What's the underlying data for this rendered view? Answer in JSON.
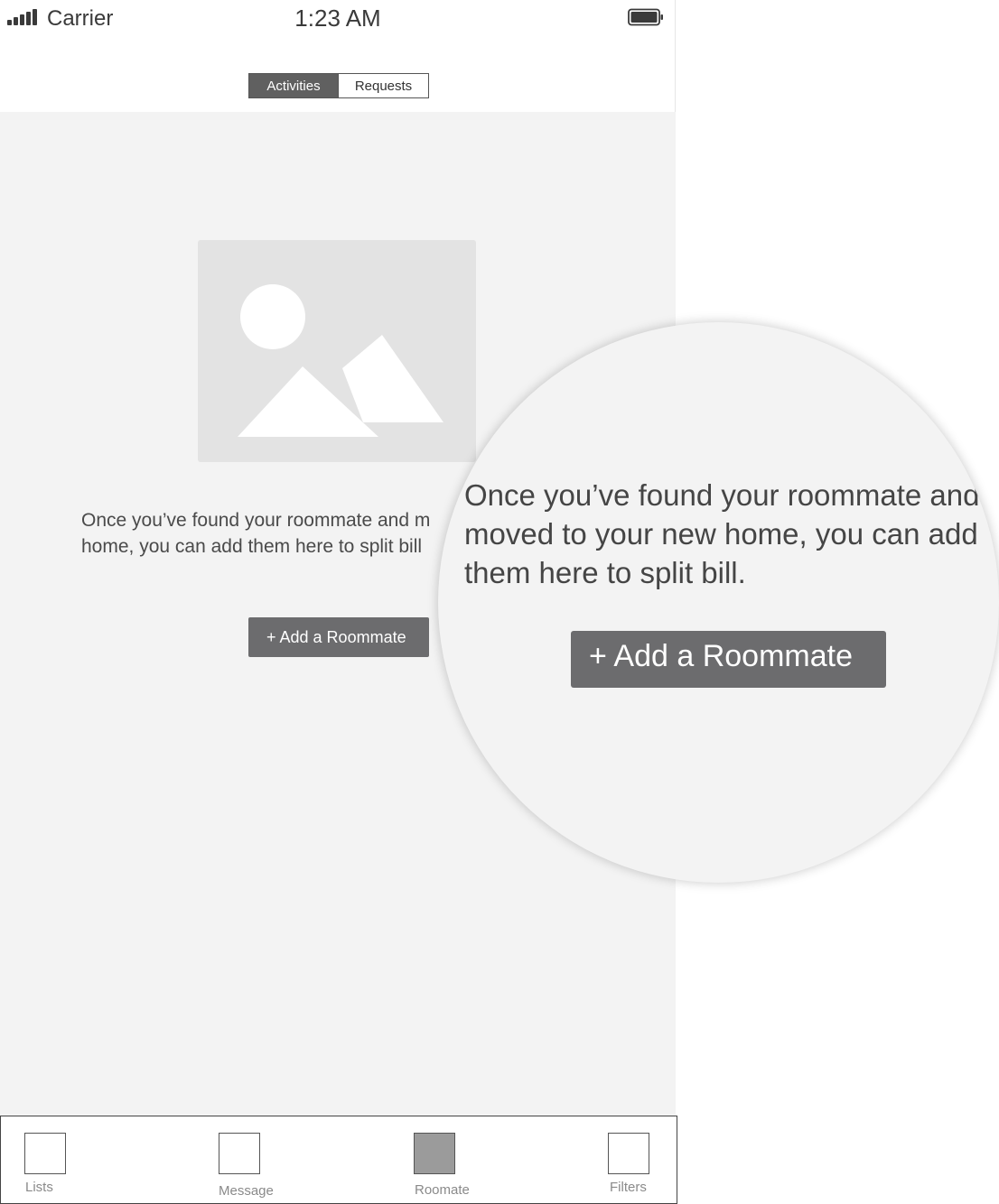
{
  "status_bar": {
    "carrier": "Carrier",
    "time": "1:23 AM",
    "signal_icon": "signal-bars-icon",
    "battery_icon": "battery-full-icon"
  },
  "segmented_control": {
    "tabs": [
      {
        "label": "Activities",
        "selected": true
      },
      {
        "label": "Requests",
        "selected": false
      }
    ]
  },
  "empty_state": {
    "image_icon": "image-placeholder-icon",
    "line1": "Once you’ve found your roommate and m",
    "line2": "home, you can add them here to split bill",
    "add_button_label": "+ Add a Roommate"
  },
  "magnifier": {
    "line1": "Once you’ve found your roommate and",
    "line2": "moved to your new home, you can add",
    "line3": "them here to split bill.",
    "button_label": "+ Add a Roommate"
  },
  "tab_bar": {
    "items": [
      {
        "label": "Lists",
        "icon": "square-outline-icon",
        "selected": false
      },
      {
        "label": "Message",
        "icon": "square-outline-icon",
        "selected": false
      },
      {
        "label": "Roomate",
        "icon": "square-filled-icon",
        "selected": true
      },
      {
        "label": "Filters",
        "icon": "square-outline-icon",
        "selected": false
      }
    ]
  },
  "colors": {
    "background": "#f3f3f3",
    "button": "#6c6c6e",
    "active_segment": "#606060",
    "selected_tab_icon": "#9b9b9b",
    "placeholder": "#e3e3e3"
  }
}
